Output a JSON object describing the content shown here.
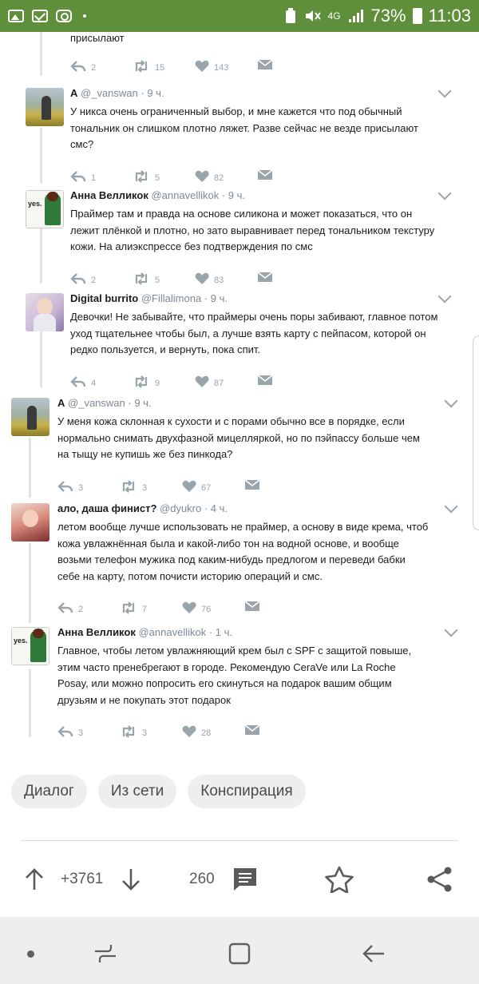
{
  "status_bar": {
    "network": "4G",
    "battery": "73%",
    "time": "11:03"
  },
  "top_fragment": {
    "text": "присылают",
    "replies": "2",
    "retweets": "15",
    "likes": "143"
  },
  "tweets": [
    {
      "name": "А",
      "handle": "@_vanswan",
      "time": "· 9 ч.",
      "text": "У никса очень ограниченный выбор, и мне кажется что под обычный тональник он слишком плотно ляжет. Разве сейчас не везде присылают смс?",
      "lines": [
        "У никса очень ограниченный выбор, и мне кажется что под обычный",
        "тональник он слишком плотно ляжет. Разве сейчас не везде присылают",
        "смс?"
      ],
      "replies": "1",
      "retweets": "5",
      "likes": "82"
    },
    {
      "name": "Анна Велликок",
      "handle": "@annavellikok",
      "time": "· 9 ч.",
      "lines": [
        "Праймер там и правда на основе силикона и может показаться, что он",
        "лежит плёнкой и плотно, но зато выравнивает перед тональником текстуру",
        "кожи. На алиэкспрессе без подтверждения по смс"
      ],
      "replies": "2",
      "retweets": "5",
      "likes": "83"
    },
    {
      "name": "Digital burrito",
      "handle": "@Fillalimona",
      "time": "· 9 ч.",
      "lines": [
        "Девочки! Не забывайте, что праймеры очень поры забивают, главное потом",
        "уход тщательнее чтобы был, а лучше взять карту с пейпасом, которой он",
        "редко пользуется, и вернуть, пока спит."
      ],
      "replies": "4",
      "retweets": "9",
      "likes": "87"
    },
    {
      "name": "А",
      "handle": "@_vanswan",
      "time": "· 9 ч.",
      "lines": [
        "У меня кожа склонная к сухости и с порами обычно все в порядке, если",
        "нормально снимать двухфазной мицелляркой, но по пэйпассу больше чем",
        "на тыщу не купишь же без пинкода?"
      ],
      "replies": "3",
      "retweets": "3",
      "likes": "67"
    },
    {
      "name": "ало, даша финист?",
      "handle": "@dyukro",
      "time": "· 4 ч.",
      "lines": [
        "летом вообще лучше использовать не праймер, а основу в виде крема, чтоб",
        "кожа увлажнённая была и какой-либо тон на водной основе, и вообще",
        "возьми телефон мужика под каким-нибудь предлогом и переведи бабки",
        "себе на карту, потом почисти историю операций и смс."
      ],
      "replies": "2",
      "retweets": "7",
      "likes": "76"
    },
    {
      "name": "Анна Велликок",
      "handle": "@annavellikok",
      "time": "· 1 ч.",
      "lines": [
        "Главное, чтобы летом увлажняющий крем был с SPF с защитой повыше,",
        "этим часто пренебрегают в городе. Рекомендую CeraVe или La Roche",
        "Posay, или можно попросить его скинуться на подарок вашим общим",
        "друзьям и не покупать этот подарок"
      ],
      "replies": "3",
      "retweets": "3",
      "likes": "28"
    }
  ],
  "avatar_labels": {
    "anna_sign": "yes."
  },
  "tags": [
    "Диалог",
    "Из сети",
    "Конспирация"
  ],
  "post_bar": {
    "rating": "+3761",
    "comments": "260"
  },
  "colors": {
    "status_bar": "#5f8f3a",
    "icon_gray": "#9aa4ab",
    "handle_gray": "#7d8a94"
  }
}
